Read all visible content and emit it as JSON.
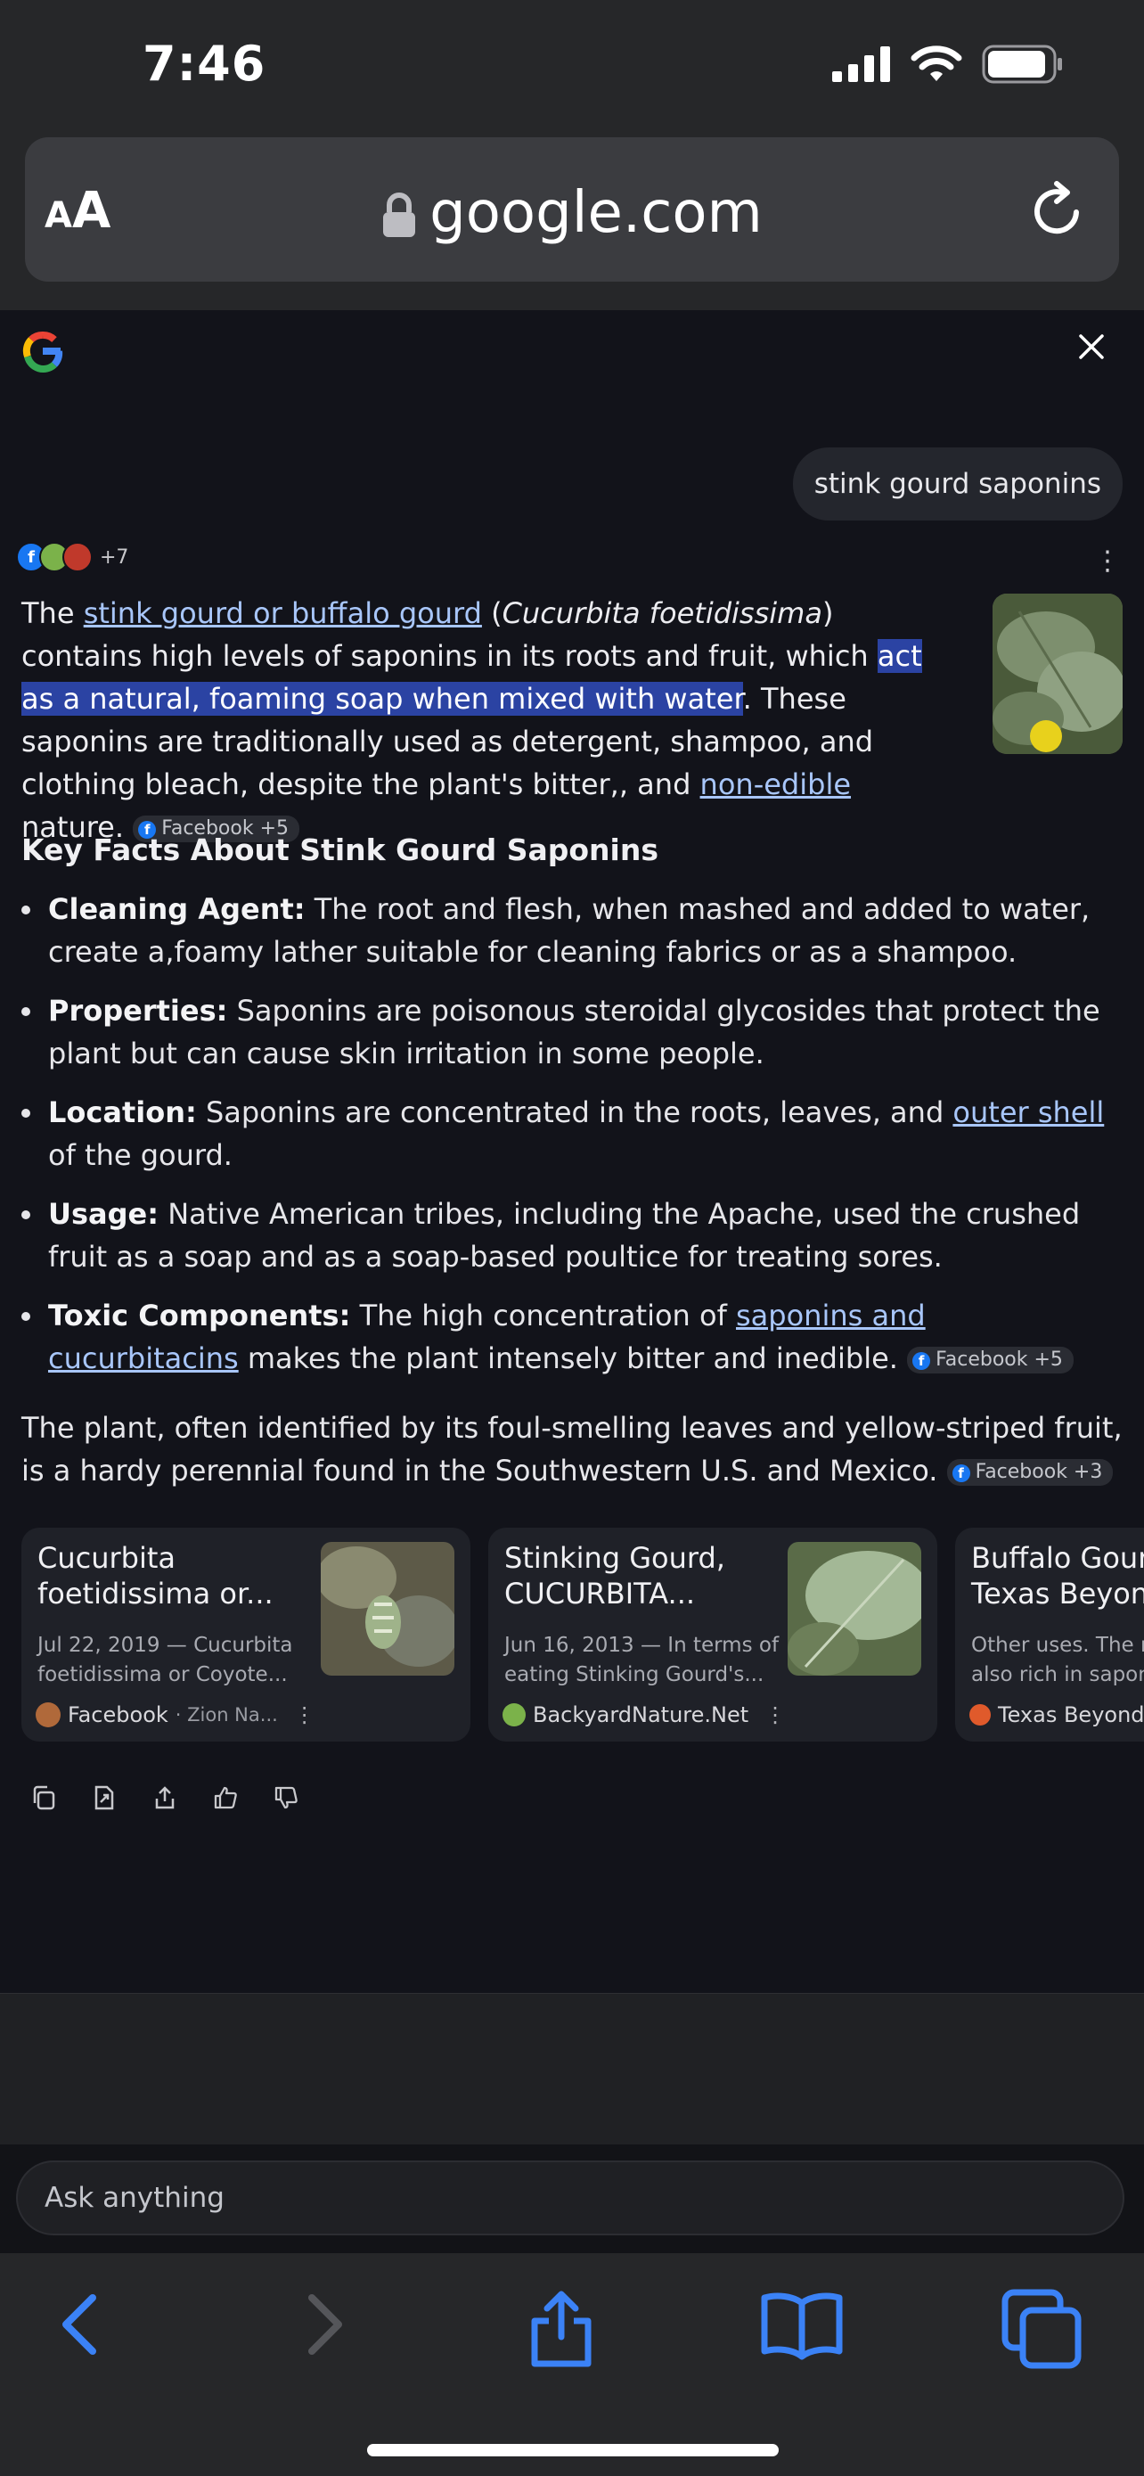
{
  "status_bar": {
    "time": "7:46"
  },
  "browser": {
    "text_size_button": "AA",
    "domain": "google.com"
  },
  "query": "stink gourd saponins",
  "sources": {
    "more_count": "+7"
  },
  "answer": {
    "p1": "The ",
    "link1": "stink gourd or buffalo gourd",
    "p2": " (",
    "p2_italic": "Cucurbita foetidissima",
    "p3": ") contains high levels of saponins in its roots and fruit, which ",
    "highlight": "act as a natural, foaming soap when mixed with water",
    "p4": ". These saponins are traditionally used as detergent, shampoo, and clothing bleach, despite the plant's bitter,, and ",
    "link2": "non-edible",
    "p5": " nature.",
    "chip": "Facebook +5"
  },
  "section_title": "Key Facts About Stink Gourd Saponins",
  "bullets": [
    {
      "title": "Cleaning Agent:",
      "text": " The root and flesh, when mashed and added to water, create a,foamy lather suitable for cleaning fabrics or as a shampoo."
    },
    {
      "title": "Properties:",
      "text": " Saponins are poisonous steroidal glycosides that protect the plant but can cause skin irritation in some people."
    },
    {
      "title": "Location:",
      "text": " Saponins are concentrated in the roots, leaves, and ",
      "link": "outer shell",
      "text2": " of the gourd."
    },
    {
      "title": "Usage:",
      "text": " Native American tribes, including the Apache, used the crushed fruit as a soap and as a soap-based poultice for treating sores."
    },
    {
      "title": "Toxic Components:",
      "text": " The high concentration of ",
      "link": "saponins and cucurbitacins",
      "text2": " makes the plant intensely bitter and inedible.",
      "chip": "Facebook +5"
    }
  ],
  "closing": {
    "text": "The plant, often identified by its foul-smelling leaves and yellow-striped fruit, is a hardy perennial found in the Southwestern U.S. and Mexico.",
    "chip": "Facebook +3"
  },
  "cards": [
    {
      "title": "Cucurbita foetidissima or...",
      "snippet": "Jul 22, 2019 — Cucurbita foetidissima or Coyote...",
      "source": "Facebook",
      "sub": "· Zion Na..."
    },
    {
      "title": "Stinking Gourd, CUCURBITA...",
      "snippet": "Jun 16, 2013 — In terms of eating Stinking Gourd's...",
      "source": "BackyardNature.Net",
      "sub": ""
    },
    {
      "title": "Buffalo Gourd - Texas Beyond",
      "snippet": "Other uses. The roots are also rich in saponins",
      "source": "Texas Beyond",
      "sub": ""
    }
  ],
  "ask_placeholder": "Ask anything",
  "colors": {
    "accent_link": "#a8c6fa",
    "highlight": "#2b43a3",
    "toolbar_blue": "#3b82f6"
  }
}
